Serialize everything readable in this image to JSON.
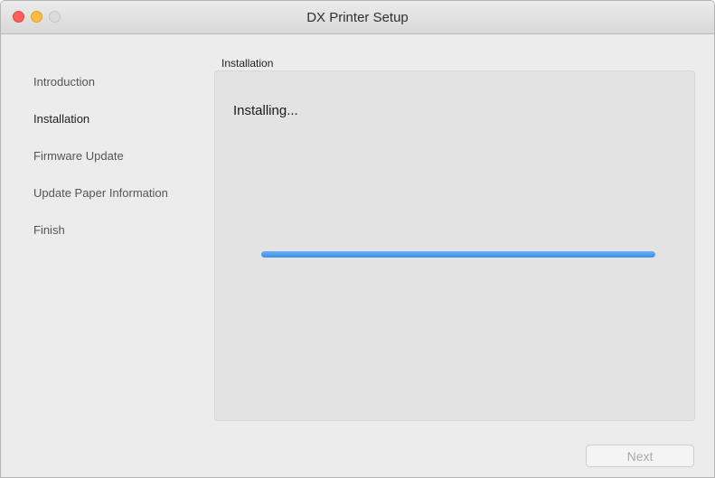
{
  "window": {
    "title": "DX Printer Setup"
  },
  "sidebar": {
    "items": [
      {
        "label": "Introduction",
        "active": false
      },
      {
        "label": "Installation",
        "active": true
      },
      {
        "label": "Firmware Update",
        "active": false
      },
      {
        "label": "Update Paper Information",
        "active": false
      },
      {
        "label": "Finish",
        "active": false
      }
    ]
  },
  "main": {
    "section_label": "Installation",
    "status_text": "Installing...",
    "progress": 1.0
  },
  "footer": {
    "next_label": "Next",
    "next_enabled": false
  },
  "colors": {
    "progress": "#3d8ee8",
    "close": "#fc605c",
    "minimize": "#fdbc40"
  }
}
